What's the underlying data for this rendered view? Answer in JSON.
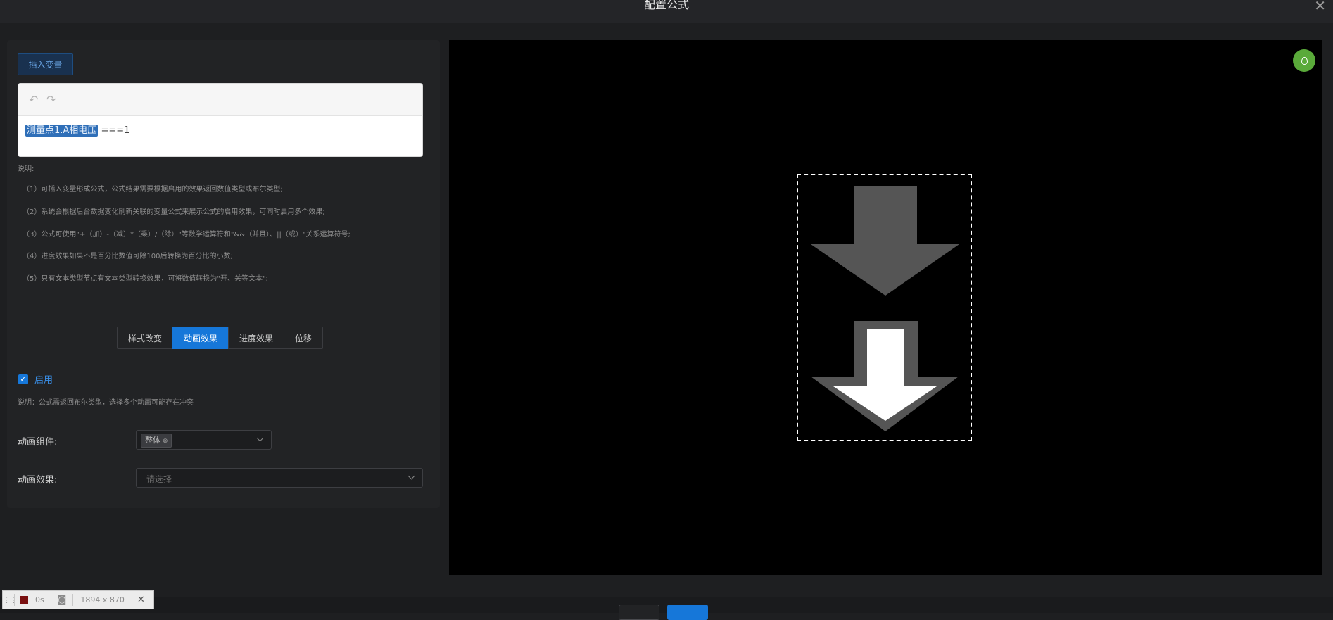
{
  "dialog": {
    "title": "配置公式",
    "close_icon": "close-icon"
  },
  "left": {
    "insert_variable_label": "插入变量",
    "editor": {
      "undo_icon": "undo-icon",
      "redo_icon": "redo-icon",
      "variable_token": "测量点1.A相电压",
      "expression_rest": "===1"
    },
    "notes": {
      "title": "说明:",
      "items": [
        "（1）可插入变量形成公式，公式结果需要根据启用的效果返回数值类型或布尔类型;",
        "（2）系统会根据后台数据变化刷新关联的变量公式来展示公式的启用效果，可同时启用多个效果;",
        "（3）公式可使用\"+（加）-（减）*（乘）/（除）\"等数学运算符和\"&&（并且）、||（或）\"关系运算符号;",
        "（4）进度效果如果不是百分比数值可除100后转换为百分比的小数;",
        "（5）只有文本类型节点有文本类型转换效果，可将数值转换为\"开、关等文本\";"
      ]
    },
    "tabs": [
      {
        "label": "样式改变",
        "active": false
      },
      {
        "label": "动画效果",
        "active": true
      },
      {
        "label": "进度效果",
        "active": false
      },
      {
        "label": "位移",
        "active": false
      }
    ],
    "enable": {
      "label": "启用",
      "checked": true
    },
    "hint": "说明：公式需返回布尔类型，选择多个动画可能存在冲突",
    "animation_component": {
      "label": "动画组件:",
      "tag": "整体"
    },
    "animation_effect": {
      "label": "动画效果:",
      "placeholder": "请选择"
    }
  },
  "preview": {
    "fab_icon": "lightbulb-icon",
    "top_arrow_color": "#555555",
    "bottom_arrow_color": "#ffffff"
  },
  "footer": {
    "cancel_label": "",
    "ok_label": ""
  },
  "recorder": {
    "time": "0s",
    "size": "1894 x 870"
  }
}
